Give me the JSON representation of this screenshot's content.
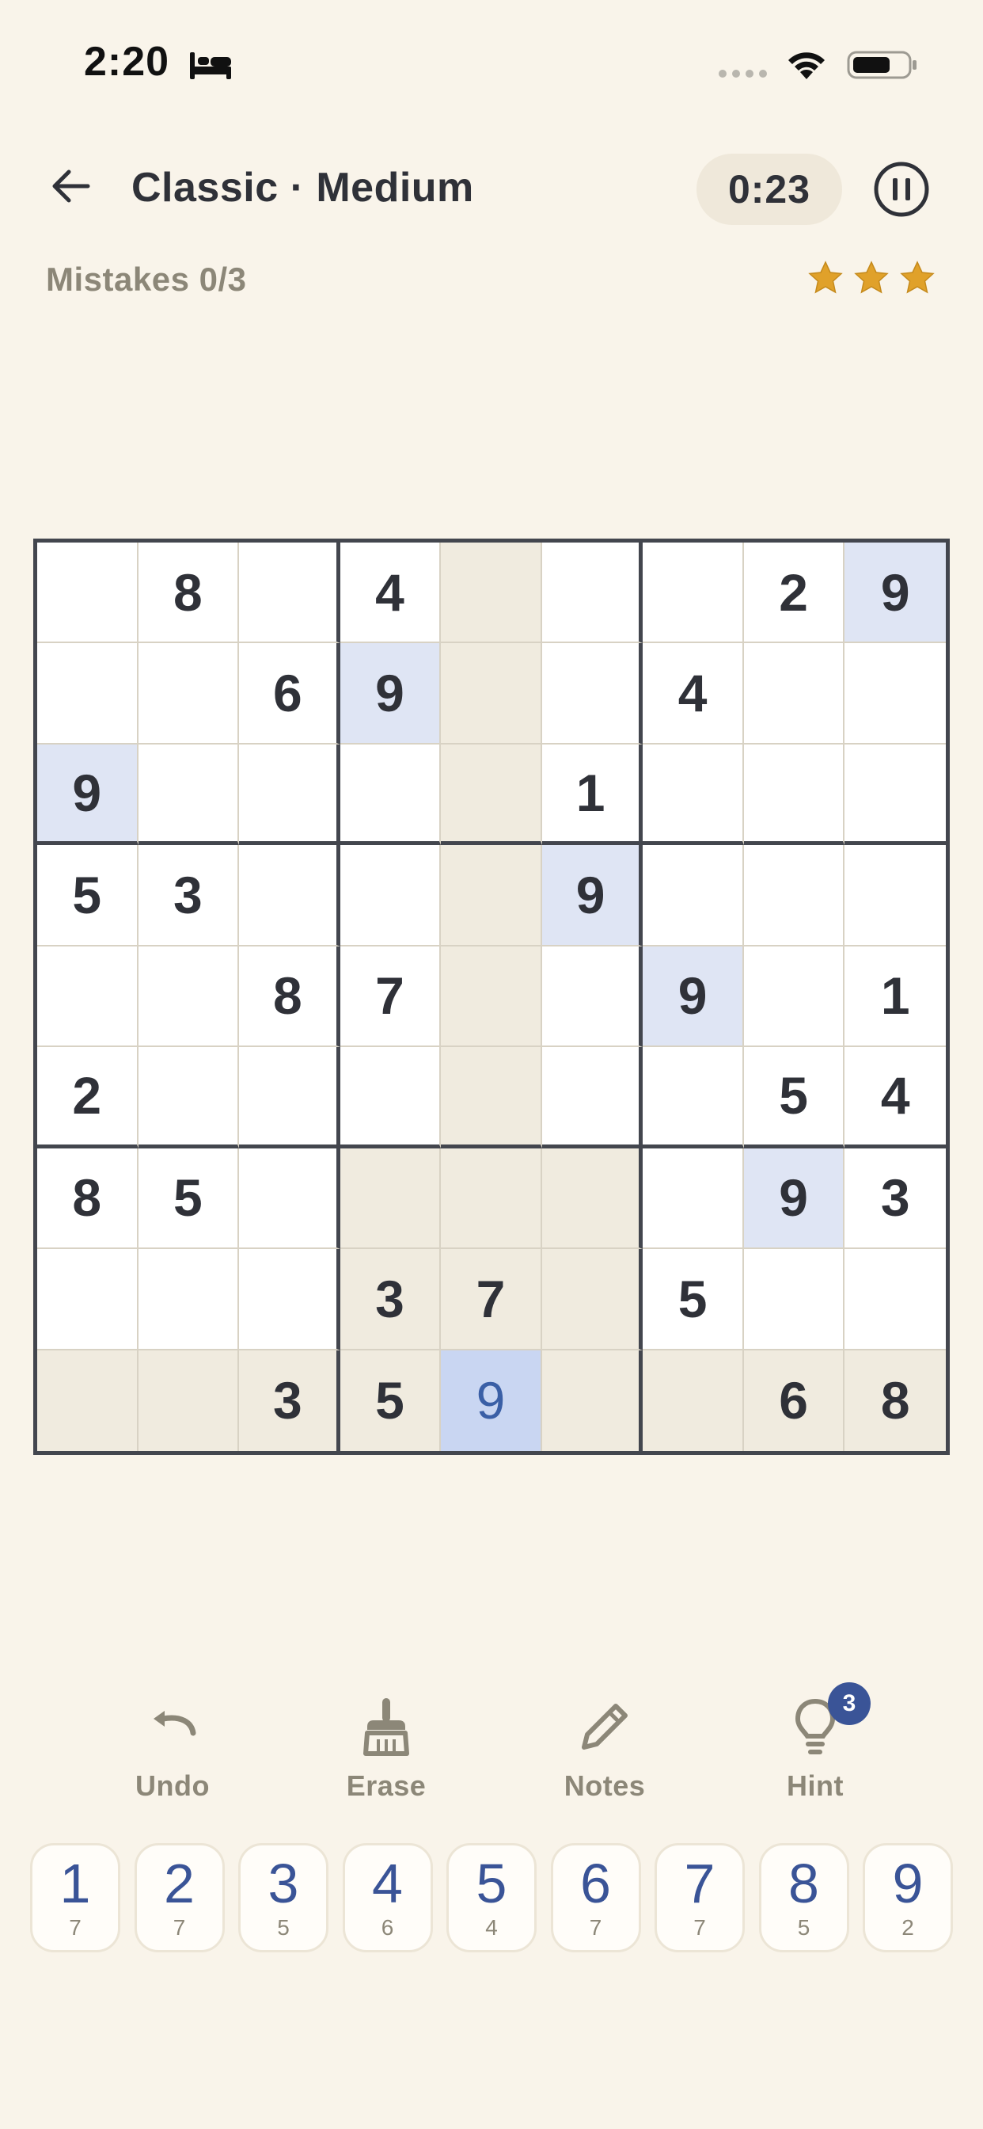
{
  "status_bar": {
    "time": "2:20"
  },
  "header": {
    "title": "Classic · Medium",
    "timer": "0:23",
    "mistakes": "Mistakes 0/3",
    "stars": 3
  },
  "board": {
    "rows": [
      [
        "",
        "8",
        "",
        "4",
        "",
        "",
        "",
        "2",
        "9"
      ],
      [
        "",
        "",
        "6",
        "9",
        "",
        "",
        "4",
        "",
        ""
      ],
      [
        "9",
        "",
        "",
        "",
        "",
        "1",
        "",
        "",
        ""
      ],
      [
        "5",
        "3",
        "",
        "",
        "",
        "9",
        "",
        "",
        ""
      ],
      [
        "",
        "",
        "8",
        "7",
        "",
        "",
        "9",
        "",
        "1"
      ],
      [
        "2",
        "",
        "",
        "",
        "",
        "",
        "",
        "5",
        "4"
      ],
      [
        "8",
        "5",
        "",
        "",
        "",
        "",
        "",
        "9",
        "3"
      ],
      [
        "",
        "",
        "",
        "3",
        "7",
        "",
        "5",
        "",
        ""
      ],
      [
        "",
        "",
        "3",
        "5",
        "9",
        "",
        "",
        "6",
        "8"
      ]
    ],
    "selected": {
      "row": 9,
      "col": 5
    }
  },
  "tools": {
    "undo": "Undo",
    "erase": "Erase",
    "notes": "Notes",
    "hint": "Hint",
    "hint_count": "3"
  },
  "numpad": [
    {
      "digit": "1",
      "remaining": "7"
    },
    {
      "digit": "2",
      "remaining": "7"
    },
    {
      "digit": "3",
      "remaining": "5"
    },
    {
      "digit": "4",
      "remaining": "6"
    },
    {
      "digit": "5",
      "remaining": "4"
    },
    {
      "digit": "6",
      "remaining": "7"
    },
    {
      "digit": "7",
      "remaining": "7"
    },
    {
      "digit": "8",
      "remaining": "5"
    },
    {
      "digit": "9",
      "remaining": "2"
    }
  ],
  "colors": {
    "background": "#f9f4ea",
    "accent": "#3a5497",
    "star": "#e0a12a",
    "highlight_related": "#f0ebdf",
    "highlight_same": "#dfe5f4"
  }
}
